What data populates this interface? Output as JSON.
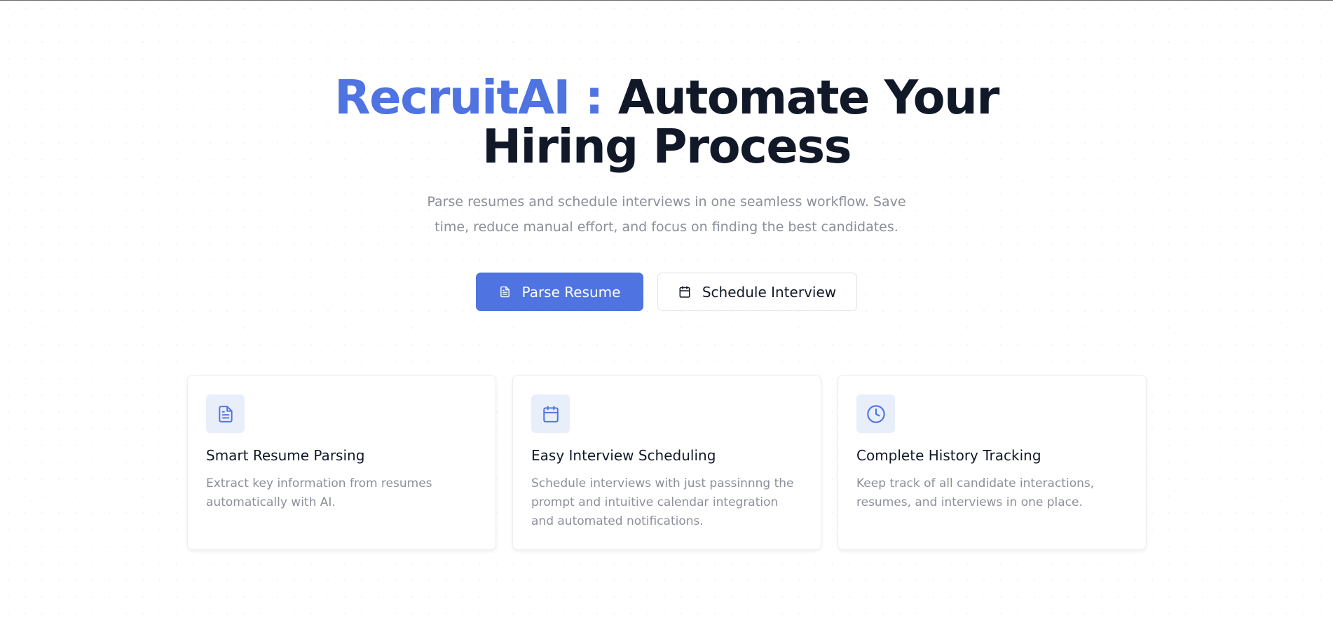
{
  "hero": {
    "brand": "RecruitAI :",
    "title": "Automate Your Hiring Process",
    "subtitle": "Parse resumes and schedule interviews in one seamless workflow. Save time, reduce manual effort, and focus on finding the best candidates."
  },
  "actions": {
    "parse_label": "Parse Resume",
    "parse_icon": "document-icon",
    "schedule_label": "Schedule Interview",
    "schedule_icon": "calendar-icon"
  },
  "features": [
    {
      "icon": "document-icon",
      "title": "Smart Resume Parsing",
      "description": "Extract key information from resumes automatically with AI."
    },
    {
      "icon": "calendar-icon",
      "title": "Easy Interview Scheduling",
      "description": "Schedule interviews with just passinnng the prompt and intuitive calendar integration and automated notifications."
    },
    {
      "icon": "clock-icon",
      "title": "Complete History Tracking",
      "description": "Keep track of all candidate interactions, resumes, and interviews in one place."
    }
  ],
  "colors": {
    "accent": "#4f73e0",
    "heading": "#111827",
    "muted": "#8b8f99",
    "icon_bg": "#e9eefb"
  }
}
